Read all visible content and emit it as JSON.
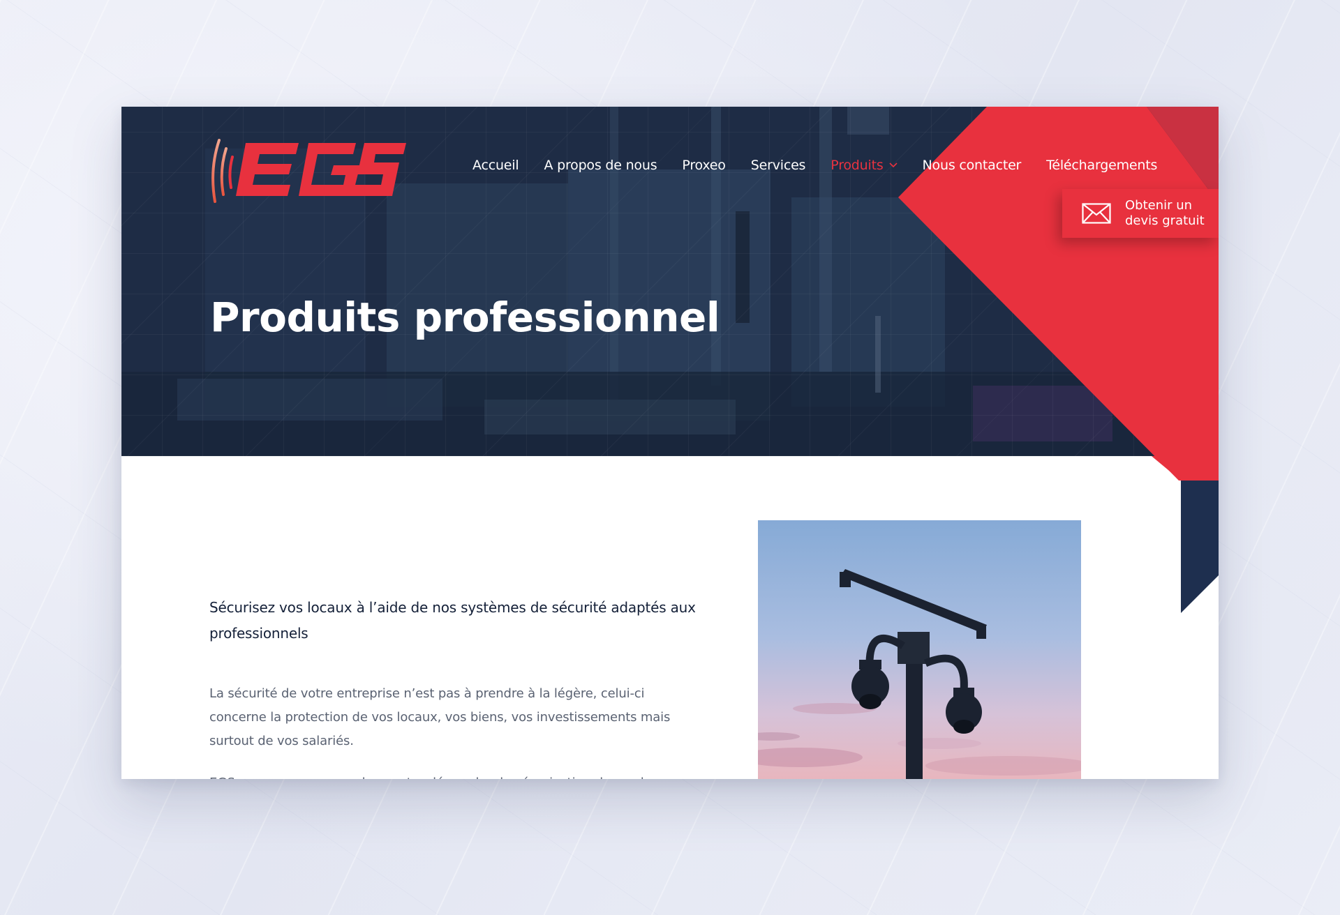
{
  "brand": {
    "logo_text": "EGS",
    "red": "#e8313e",
    "navy": "#1e2f4f"
  },
  "nav": {
    "items": [
      {
        "label": "Accueil",
        "active": false
      },
      {
        "label": "A propos de nous",
        "active": false
      },
      {
        "label": "Proxeo",
        "active": false
      },
      {
        "label": "Services",
        "active": false
      },
      {
        "label": "Produits",
        "active": true,
        "has_dropdown": true
      },
      {
        "label": "Nous contacter",
        "active": false
      },
      {
        "label": "Téléchargements",
        "active": false
      }
    ]
  },
  "quote_button": {
    "label": "Obtenir un devis gratuit",
    "icon": "envelope-icon"
  },
  "hero": {
    "title": "Produits professionnel"
  },
  "content": {
    "heading": "Sécurisez vos locaux à l’aide de nos systèmes de sécurité adaptés aux professionnels",
    "paragraph": "La sécurité de votre entreprise n’est pas à prendre à la légère, celui-ci concerne la protection de vos locaux, vos biens, vos investissements mais surtout de vos salariés.",
    "paragraph_cut": "EGS vous accompagne dans votre démarche de sécurisation de vos locaux"
  },
  "image": {
    "subject": "security-camera-pole"
  }
}
